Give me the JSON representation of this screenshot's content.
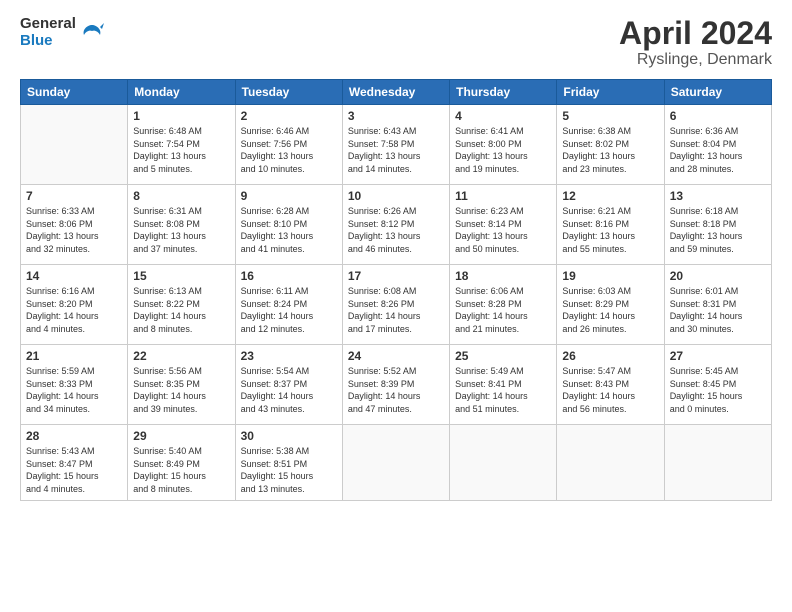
{
  "header": {
    "logo_line1": "General",
    "logo_line2": "Blue",
    "title": "April 2024",
    "subtitle": "Ryslinge, Denmark"
  },
  "days_of_week": [
    "Sunday",
    "Monday",
    "Tuesday",
    "Wednesday",
    "Thursday",
    "Friday",
    "Saturday"
  ],
  "weeks": [
    [
      {
        "day": "",
        "info": ""
      },
      {
        "day": "1",
        "info": "Sunrise: 6:48 AM\nSunset: 7:54 PM\nDaylight: 13 hours\nand 5 minutes."
      },
      {
        "day": "2",
        "info": "Sunrise: 6:46 AM\nSunset: 7:56 PM\nDaylight: 13 hours\nand 10 minutes."
      },
      {
        "day": "3",
        "info": "Sunrise: 6:43 AM\nSunset: 7:58 PM\nDaylight: 13 hours\nand 14 minutes."
      },
      {
        "day": "4",
        "info": "Sunrise: 6:41 AM\nSunset: 8:00 PM\nDaylight: 13 hours\nand 19 minutes."
      },
      {
        "day": "5",
        "info": "Sunrise: 6:38 AM\nSunset: 8:02 PM\nDaylight: 13 hours\nand 23 minutes."
      },
      {
        "day": "6",
        "info": "Sunrise: 6:36 AM\nSunset: 8:04 PM\nDaylight: 13 hours\nand 28 minutes."
      }
    ],
    [
      {
        "day": "7",
        "info": "Sunrise: 6:33 AM\nSunset: 8:06 PM\nDaylight: 13 hours\nand 32 minutes."
      },
      {
        "day": "8",
        "info": "Sunrise: 6:31 AM\nSunset: 8:08 PM\nDaylight: 13 hours\nand 37 minutes."
      },
      {
        "day": "9",
        "info": "Sunrise: 6:28 AM\nSunset: 8:10 PM\nDaylight: 13 hours\nand 41 minutes."
      },
      {
        "day": "10",
        "info": "Sunrise: 6:26 AM\nSunset: 8:12 PM\nDaylight: 13 hours\nand 46 minutes."
      },
      {
        "day": "11",
        "info": "Sunrise: 6:23 AM\nSunset: 8:14 PM\nDaylight: 13 hours\nand 50 minutes."
      },
      {
        "day": "12",
        "info": "Sunrise: 6:21 AM\nSunset: 8:16 PM\nDaylight: 13 hours\nand 55 minutes."
      },
      {
        "day": "13",
        "info": "Sunrise: 6:18 AM\nSunset: 8:18 PM\nDaylight: 13 hours\nand 59 minutes."
      }
    ],
    [
      {
        "day": "14",
        "info": "Sunrise: 6:16 AM\nSunset: 8:20 PM\nDaylight: 14 hours\nand 4 minutes."
      },
      {
        "day": "15",
        "info": "Sunrise: 6:13 AM\nSunset: 8:22 PM\nDaylight: 14 hours\nand 8 minutes."
      },
      {
        "day": "16",
        "info": "Sunrise: 6:11 AM\nSunset: 8:24 PM\nDaylight: 14 hours\nand 12 minutes."
      },
      {
        "day": "17",
        "info": "Sunrise: 6:08 AM\nSunset: 8:26 PM\nDaylight: 14 hours\nand 17 minutes."
      },
      {
        "day": "18",
        "info": "Sunrise: 6:06 AM\nSunset: 8:28 PM\nDaylight: 14 hours\nand 21 minutes."
      },
      {
        "day": "19",
        "info": "Sunrise: 6:03 AM\nSunset: 8:29 PM\nDaylight: 14 hours\nand 26 minutes."
      },
      {
        "day": "20",
        "info": "Sunrise: 6:01 AM\nSunset: 8:31 PM\nDaylight: 14 hours\nand 30 minutes."
      }
    ],
    [
      {
        "day": "21",
        "info": "Sunrise: 5:59 AM\nSunset: 8:33 PM\nDaylight: 14 hours\nand 34 minutes."
      },
      {
        "day": "22",
        "info": "Sunrise: 5:56 AM\nSunset: 8:35 PM\nDaylight: 14 hours\nand 39 minutes."
      },
      {
        "day": "23",
        "info": "Sunrise: 5:54 AM\nSunset: 8:37 PM\nDaylight: 14 hours\nand 43 minutes."
      },
      {
        "day": "24",
        "info": "Sunrise: 5:52 AM\nSunset: 8:39 PM\nDaylight: 14 hours\nand 47 minutes."
      },
      {
        "day": "25",
        "info": "Sunrise: 5:49 AM\nSunset: 8:41 PM\nDaylight: 14 hours\nand 51 minutes."
      },
      {
        "day": "26",
        "info": "Sunrise: 5:47 AM\nSunset: 8:43 PM\nDaylight: 14 hours\nand 56 minutes."
      },
      {
        "day": "27",
        "info": "Sunrise: 5:45 AM\nSunset: 8:45 PM\nDaylight: 15 hours\nand 0 minutes."
      }
    ],
    [
      {
        "day": "28",
        "info": "Sunrise: 5:43 AM\nSunset: 8:47 PM\nDaylight: 15 hours\nand 4 minutes."
      },
      {
        "day": "29",
        "info": "Sunrise: 5:40 AM\nSunset: 8:49 PM\nDaylight: 15 hours\nand 8 minutes."
      },
      {
        "day": "30",
        "info": "Sunrise: 5:38 AM\nSunset: 8:51 PM\nDaylight: 15 hours\nand 13 minutes."
      },
      {
        "day": "",
        "info": ""
      },
      {
        "day": "",
        "info": ""
      },
      {
        "day": "",
        "info": ""
      },
      {
        "day": "",
        "info": ""
      }
    ]
  ]
}
